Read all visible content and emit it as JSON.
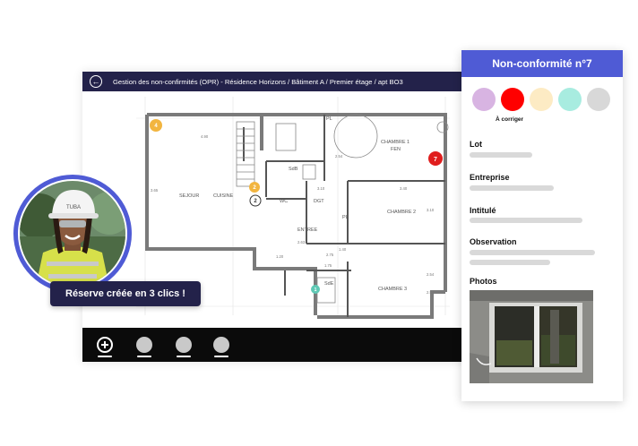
{
  "app": {
    "breadcrumb": "Gestion des non-confirmités (OPR) - Résidence Horizons / Bâtiment A / Premier étage / apt BO3",
    "back_icon": "arrow-left-icon"
  },
  "plan": {
    "rooms": {
      "sejour": "SEJOUR",
      "cuisine": "CUISINE",
      "wc": "WC",
      "dgt": "DGT",
      "entree": "ENTREE",
      "chambre1": "CHAMBRE 1",
      "chambre2": "CHAMBRE 2",
      "chambre3": "CHAMBRE 3",
      "sdb": "SdB",
      "sde": "SdE",
      "pl1": "PL",
      "pl2": "PL",
      "fen": "FEN"
    },
    "dimensions": {
      "d1": "4.90",
      "d2": "3.65",
      "d3": "3.10",
      "d4": "2.54",
      "d5": "2.63",
      "d6": "3.40",
      "d7": "2.75",
      "d8": "1.75",
      "d9": "1.20",
      "d10": "3.10",
      "d11": "2.54",
      "d12": "1.40",
      "d13": "2.54"
    },
    "markers": {
      "m4": "4",
      "m2a": "2",
      "m2b": "2",
      "m7": "7",
      "m_small": "1"
    }
  },
  "toolbar": {
    "tools": [
      {
        "icon": "plus-circle-icon"
      },
      {
        "icon": "circle-icon"
      },
      {
        "icon": "circle-icon"
      },
      {
        "icon": "circle-icon"
      }
    ]
  },
  "panel": {
    "title": "Non-conformité n°7",
    "selected_status": "À corriger",
    "status_colors": [
      "#d8b4e2",
      "#ff0000",
      "#fdebc4",
      "#a8ece0",
      "#d8d8d8"
    ],
    "fields": {
      "lot": "Lot",
      "entreprise": "Entreprise",
      "intitule": "Intitulé",
      "observation": "Observation",
      "photos": "Photos"
    }
  },
  "badge": {
    "text": "Réserve créée en 3 clics !"
  },
  "helmet_text": "TUBA"
}
